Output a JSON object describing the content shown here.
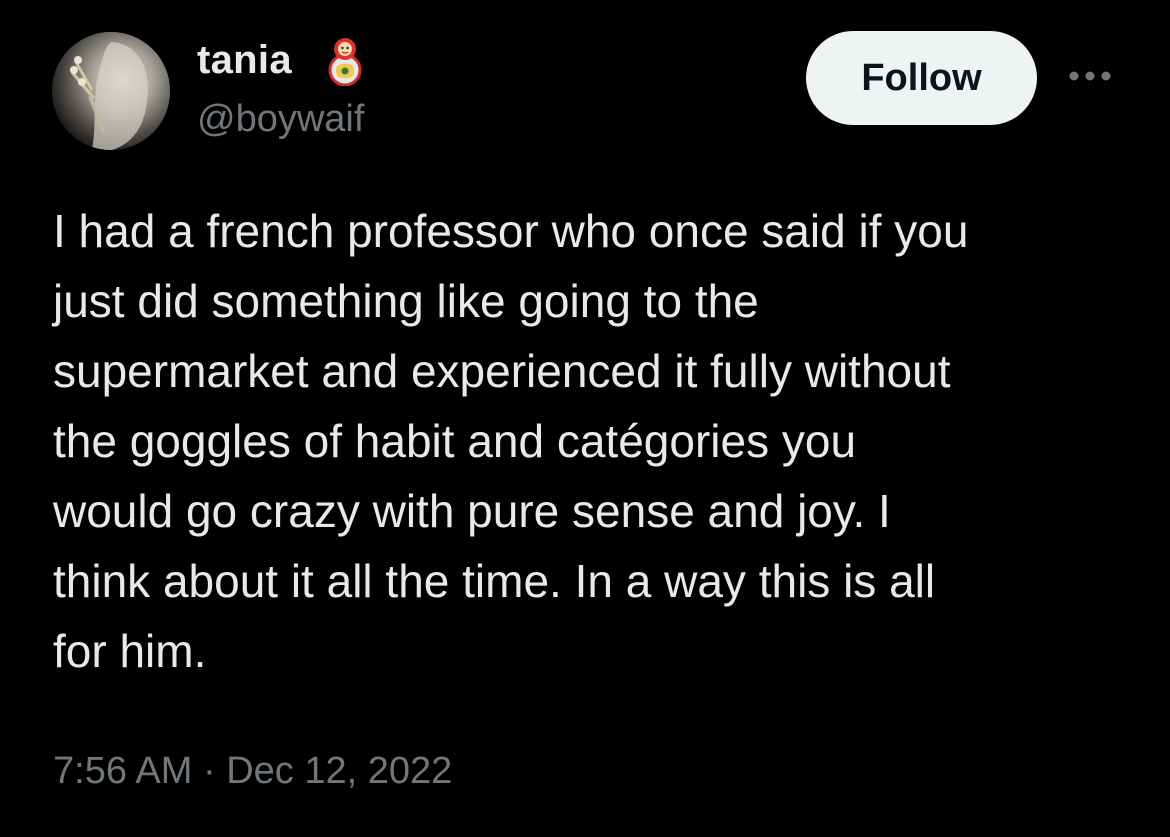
{
  "author": {
    "display_name": "tania",
    "name_badge_icon": "matryoshka-doll-icon",
    "handle": "@boywaif",
    "avatar_icon": "profile-photo"
  },
  "actions": {
    "follow_label": "Follow",
    "more_icon": "more-horizontal-icon"
  },
  "tweet": {
    "text": "I had a french professor who once said if you\njust did something like going to the\nsupermarket and experienced it fully without\nthe goggles of habit and catégories you\nwould go crazy with pure sense and joy. I\nthink about it all the time. In a way this is all\nfor him.",
    "time": "7:56 AM",
    "separator": "·",
    "date": "Dec 12, 2022"
  },
  "colors": {
    "background": "#000000",
    "primary_text": "#e7e9ea",
    "secondary_text": "#71767b",
    "follow_bg": "#eff3f4",
    "follow_text": "#0f1419"
  }
}
